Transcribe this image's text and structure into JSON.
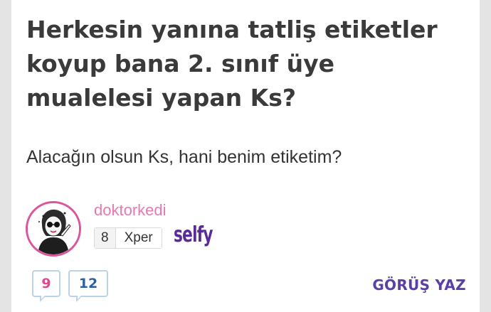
{
  "post": {
    "title": "Herkesin yanına tatliş etiketler koyup bana 2. sınıf üye mualelesi yapan Ks?",
    "body": "Alacağın olsun Ks, hani benim etiketim?"
  },
  "author": {
    "username": "doktorkedi",
    "level": "8",
    "level_label": "Xper",
    "badge": "selfy"
  },
  "counts": {
    "first": "9",
    "second": "12"
  },
  "actions": {
    "comment_label": "GÖRÜŞ YAZ"
  },
  "colors": {
    "username": "#e879b0",
    "avatar_ring": "#d9569a",
    "badge": "#5a2a98",
    "count_first": "#e2468c",
    "count_second": "#2c5fa3",
    "action": "#5b3fa8"
  }
}
